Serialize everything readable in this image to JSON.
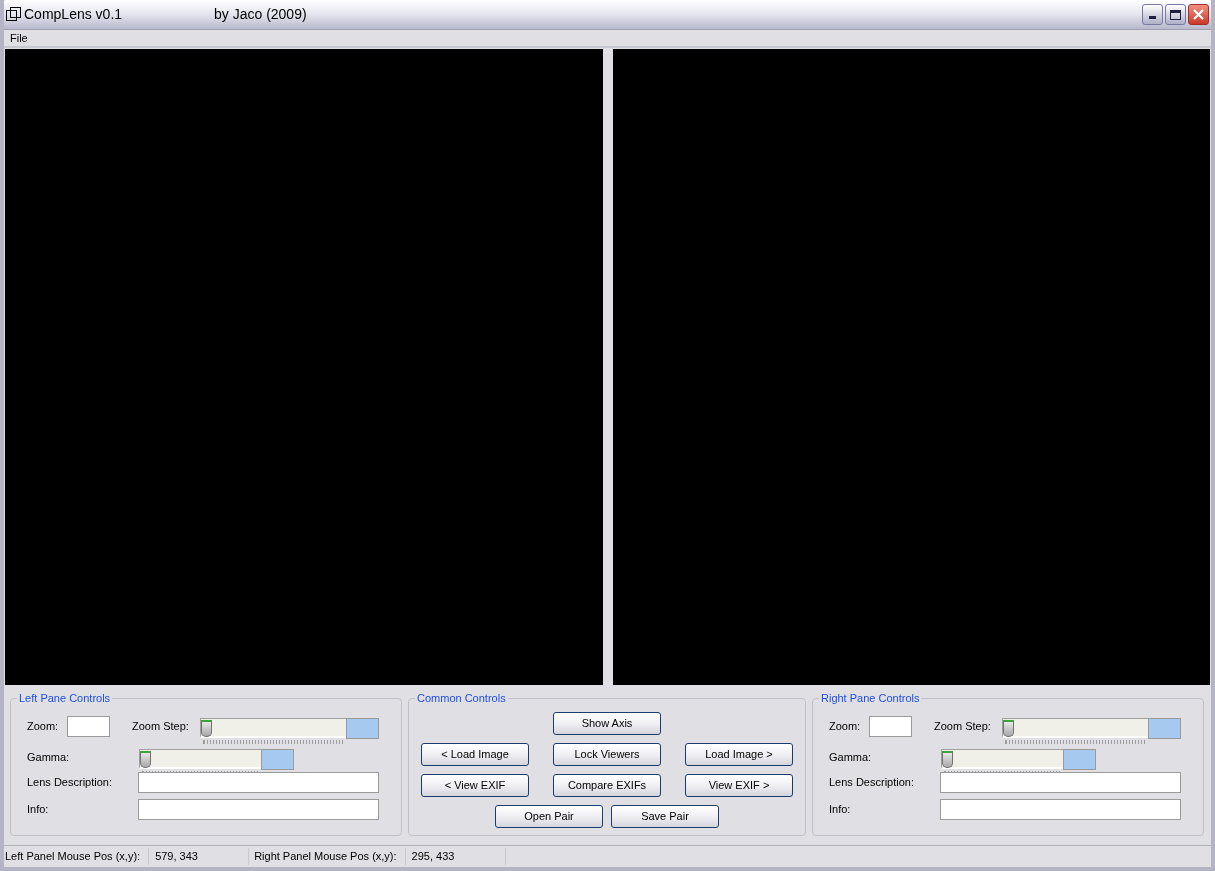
{
  "window": {
    "title": "CompLens v0.1",
    "subtitle": "by Jaco (2009)"
  },
  "menu": [
    "File"
  ],
  "panes": [
    {
      "title": "Left Pane Controls",
      "zoom": {
        "label": "Zoom:"
      },
      "zoom_step": {
        "label": "Zoom Step:",
        "level": 0
      },
      "gamma": {
        "label": "Gamma:",
        "level": 0
      },
      "lens_description": {
        "label": "Lens Description:"
      },
      "info": {
        "label": "Info:"
      }
    },
    {
      "title": "Right Pane Controls",
      "zoom": {
        "label": "Zoom:"
      },
      "zoom_step": {
        "label": "Zoom Step:",
        "level": 0
      },
      "gamma": {
        "label": "Gamma:",
        "level": 0
      },
      "lens_description": {
        "label": "Lens Description:"
      },
      "info": {
        "label": "Info:"
      }
    }
  ],
  "common_controls": {
    "title": "Common Controls",
    "left_buttons": [
      "< Load Image",
      "< View EXIF"
    ],
    "center_buttons": [
      "Show Axis",
      "Lock Viewers",
      "Compare EXIFs"
    ],
    "right_buttons": [
      "Load Image >",
      "View EXIF >"
    ],
    "bottom_buttons": [
      "Open Pair",
      "Save Pair"
    ]
  },
  "status_bar": [
    {
      "label": "Left Panel Mouse Pos (x,y):",
      "value": "579, 343"
    },
    {
      "label": "Right Panel Mouse Pos (x,y):",
      "value": "295, 433"
    }
  ]
}
